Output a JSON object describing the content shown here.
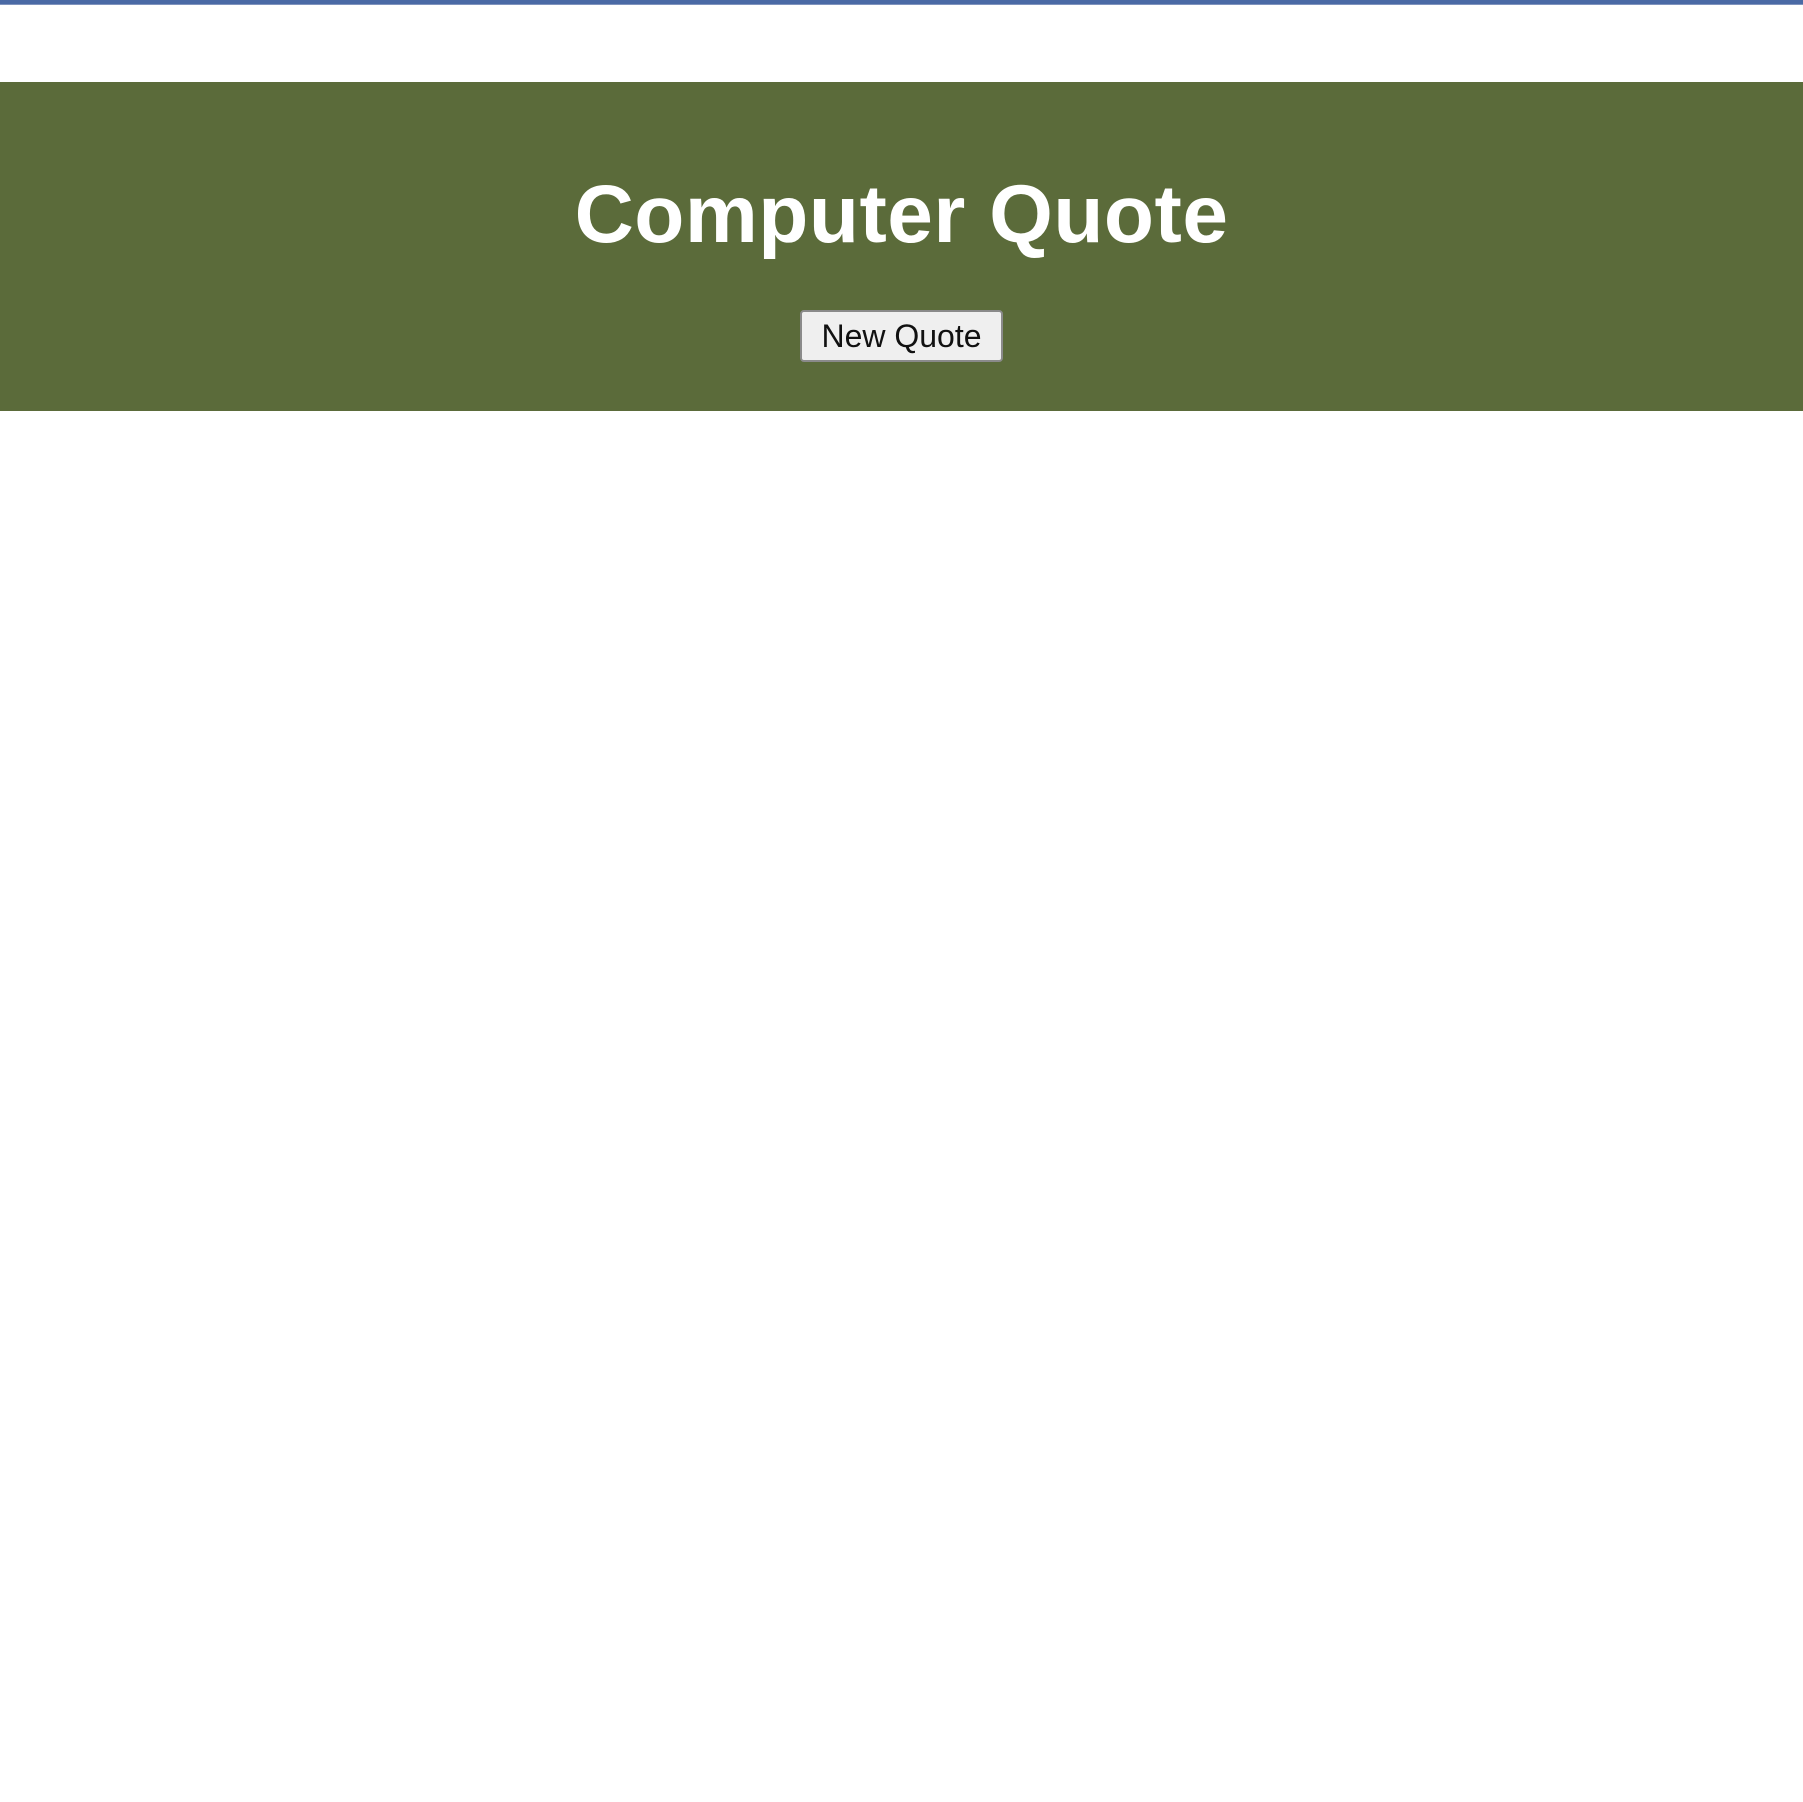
{
  "page": {
    "background": "#ffffff",
    "top_border_color": "#4a6aa5"
  },
  "banner": {
    "title": "Computer Quote",
    "background": "#5b6b3a",
    "title_color": "#ffffff",
    "button_label": "New Quote"
  }
}
